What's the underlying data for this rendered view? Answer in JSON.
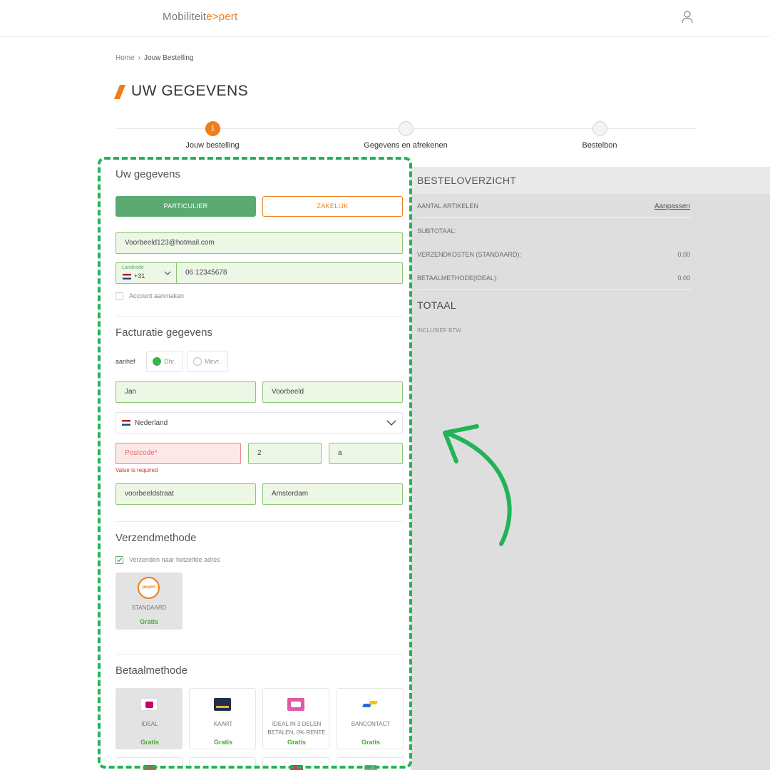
{
  "header": {
    "logo_main": "Mobiliteit",
    "logo_accent": "e>pert",
    "user_icon": "user-icon"
  },
  "breadcrumb": {
    "home": "Home",
    "separator": "›",
    "current": "Jouw Bestelling"
  },
  "page_title": "UW GEGEVENS",
  "stepper": {
    "steps": [
      {
        "number": "1",
        "label": "Jouw bestelling",
        "active": true
      },
      {
        "number": "",
        "label": "Gegevens en afrekenen",
        "active": false
      },
      {
        "number": "",
        "label": "Bestelbon",
        "active": false
      }
    ]
  },
  "customer": {
    "section_title": "Uw gegevens",
    "type_particulier": "PARTICULIER",
    "type_zakelijk": "ZAKELIJK",
    "selected_type": "PARTICULIER",
    "email": "Voorbeeld123@hotmail.com",
    "phone_code_label": "Landcode",
    "phone_code": "+31",
    "phone_number": "06 12345678",
    "create_account_label": "Account aanmaken",
    "create_account_checked": false
  },
  "billing": {
    "section_title": "Facturatie gegevens",
    "salutation_label": "aanhef",
    "salutation_options": [
      "Dhr.",
      "Mevr."
    ],
    "salutation_selected": "Dhr.",
    "first_name": "Jan",
    "last_name": "Voorbeeld",
    "country": "Nederland",
    "postcode_placeholder": "Postcode*",
    "postcode_error": "Value is required",
    "house_number": "2",
    "house_addition": "a",
    "street": "voorbeeldstraat",
    "city": "Amsterdam"
  },
  "shipping": {
    "section_title": "Verzendmethode",
    "same_address_label": "Verzenden naar hetzelfde adres",
    "same_address_checked": true,
    "carrier_logo_text": "postnl",
    "method_name": "STANDAARD",
    "method_price": "Gratis"
  },
  "payment": {
    "section_title": "Betaalmethode",
    "methods": [
      {
        "name": "IDEAL",
        "price": "Gratis",
        "icon": "ideal-icon",
        "selected": true
      },
      {
        "name": "KAART",
        "price": "Gratis",
        "icon": "card-icon",
        "selected": false
      },
      {
        "name": "IDEAL IN 3 DELEN BETALEN, 0% RENTE",
        "price": "Gratis",
        "icon": "ideal-in3-icon",
        "selected": false
      },
      {
        "name": "BANCONTACT",
        "price": "Gratis",
        "icon": "bancontact-icon",
        "selected": false
      }
    ]
  },
  "summary": {
    "title": "BESTELOVERZICHT",
    "items_label": "AANTAL ARTIKELEN",
    "edit_link": "Aanpassen",
    "subtotal_label": "SUBTOTAAL:",
    "shipping_label": "VERZENDKOSTEN (STANDAARD):",
    "shipping_value": "0.00",
    "payment_label": "BETAALMETHODE(IDEAL):",
    "payment_value": "0.00",
    "total_label": "TOTAAL",
    "vat_label": "INCLUSIEF BTW"
  },
  "colors": {
    "brand_orange": "#ee7d1a",
    "primary_green": "#5aaa72",
    "field_valid_bg": "#ecf7e6",
    "field_error_bg": "#fde8e8",
    "annotation_green": "#23b357",
    "summary_bg": "#dedede"
  }
}
